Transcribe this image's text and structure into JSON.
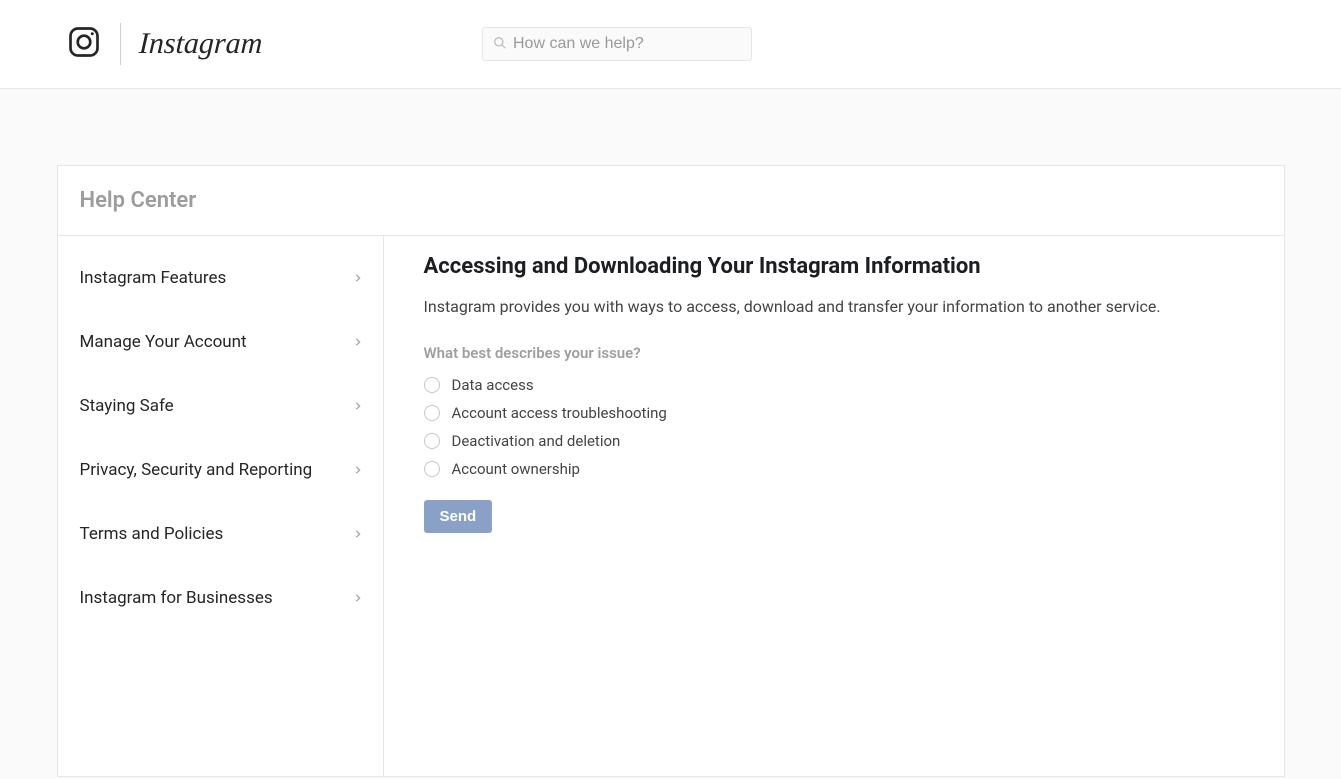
{
  "brand": "Instagram",
  "search": {
    "placeholder": "How can we help?"
  },
  "help_center_label": "Help Center",
  "sidebar": {
    "items": [
      {
        "label": "Instagram Features"
      },
      {
        "label": "Manage Your Account"
      },
      {
        "label": "Staying Safe"
      },
      {
        "label": "Privacy, Security and Reporting"
      },
      {
        "label": "Terms and Policies"
      },
      {
        "label": "Instagram for Businesses"
      }
    ]
  },
  "main": {
    "title": "Accessing and Downloading Your Instagram Information",
    "intro": "Instagram provides you with ways to access, download and transfer your information to another service.",
    "question": "What best describes your issue?",
    "options": [
      {
        "label": "Data access"
      },
      {
        "label": "Account access troubleshooting"
      },
      {
        "label": "Deactivation and deletion"
      },
      {
        "label": "Account ownership"
      }
    ],
    "send_label": "Send"
  }
}
